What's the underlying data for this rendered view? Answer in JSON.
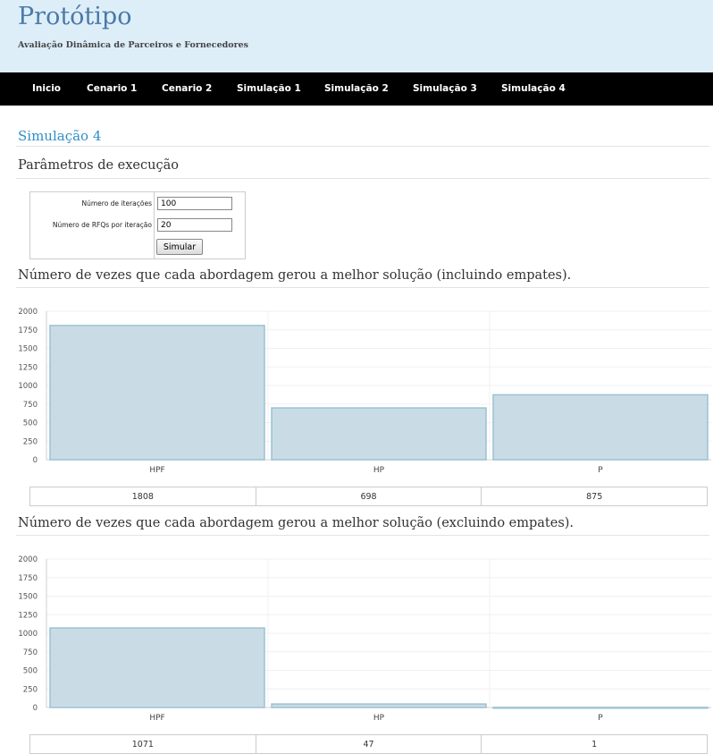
{
  "header": {
    "title": "Protótipo",
    "subtitle": "Avaliação Dinâmica de Parceiros e Fornecedores"
  },
  "nav": {
    "items": [
      "Inicio",
      "Cenario 1",
      "Cenario 2",
      "Simulação 1",
      "Simulação 2",
      "Simulação 3",
      "Simulação 4"
    ]
  },
  "page": {
    "title": "Simulação 4",
    "params_heading": "Parâmetros de execução"
  },
  "params": {
    "iterations_label": "Número de iterações",
    "iterations_value": "100",
    "rfqs_label": "Número de RFQs por iteração",
    "rfqs_value": "20",
    "button_label": "Simular"
  },
  "chart_data": [
    {
      "type": "bar",
      "title": "Número de vezes que cada abordagem gerou a melhor solução (incluindo empates).",
      "categories": [
        "HPF",
        "HP",
        "P"
      ],
      "values": [
        1808,
        698,
        875
      ],
      "ylim": [
        0,
        2000
      ],
      "yticks": [
        0,
        250,
        500,
        750,
        1000,
        1250,
        1500,
        1750,
        2000
      ],
      "grid": true,
      "bar_color": "#c9dce6",
      "bar_border_color": "#9bc1d2"
    },
    {
      "type": "bar",
      "title": "Número de vezes que cada abordagem gerou a melhor solução (excluindo empates).",
      "categories": [
        "HPF",
        "HP",
        "P"
      ],
      "values": [
        1071,
        47,
        1
      ],
      "ylim": [
        0,
        2000
      ],
      "yticks": [
        0,
        250,
        500,
        750,
        1000,
        1250,
        1500,
        1750,
        2000
      ],
      "grid": true,
      "bar_color": "#c9dce6",
      "bar_border_color": "#9bc1d2"
    }
  ]
}
